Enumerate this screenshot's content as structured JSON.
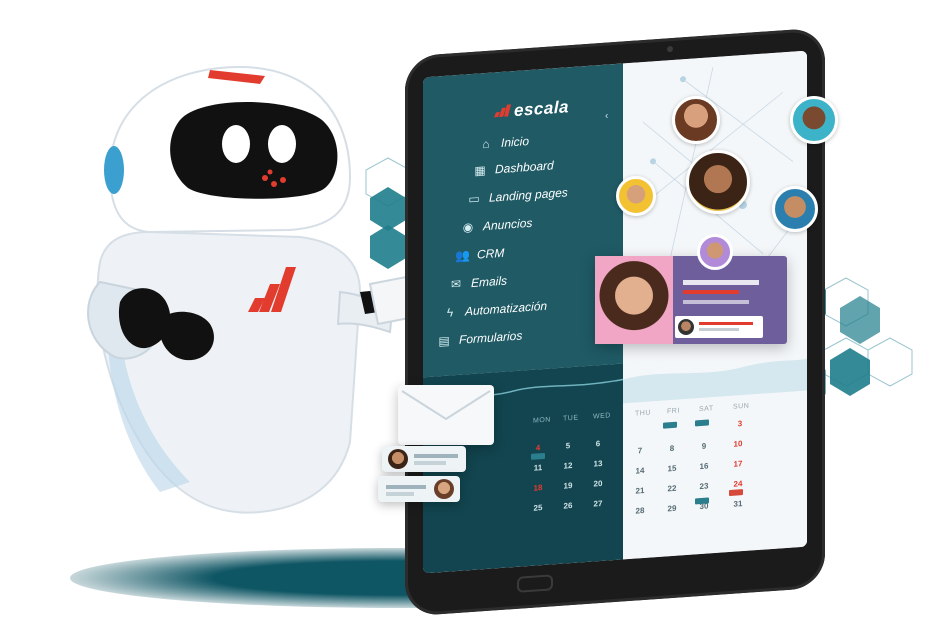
{
  "brand": {
    "logo_text": "escala",
    "logo_icon": "bar-chart-logo-icon",
    "accent_color": "#e23c2f",
    "primary_color": "#1f5a65",
    "dark_color": "#12454f"
  },
  "sidebar": {
    "items": [
      {
        "label": "Inicio",
        "icon": "home-icon"
      },
      {
        "label": "Dashboard",
        "icon": "dashboard-icon"
      },
      {
        "label": "Landing pages",
        "icon": "landing-page-icon"
      },
      {
        "label": "Anuncios",
        "icon": "megaphone-icon"
      },
      {
        "label": "CRM",
        "icon": "users-icon"
      },
      {
        "label": "Emails",
        "icon": "mail-icon"
      },
      {
        "label": "Automatización",
        "icon": "lightning-icon"
      },
      {
        "label": "Formularios",
        "icon": "form-icon"
      }
    ]
  },
  "calendar": {
    "left_headers": [
      "MON",
      "TUE",
      "WED"
    ],
    "right_headers": [
      "THU",
      "FRI",
      "SAT",
      "SUN"
    ],
    "left_rows": [
      [
        "4",
        "5",
        "6"
      ],
      [
        "11",
        "12",
        "13"
      ],
      [
        "18",
        "19",
        "20"
      ],
      [
        "25",
        "26",
        "27"
      ]
    ],
    "right_rows": [
      [
        "",
        "",
        "",
        "3"
      ],
      [
        "7",
        "8",
        "9",
        "10"
      ],
      [
        "14",
        "15",
        "16",
        "17"
      ],
      [
        "21",
        "22",
        "23",
        "24"
      ],
      [
        "28",
        "29",
        "30",
        "31"
      ]
    ]
  }
}
